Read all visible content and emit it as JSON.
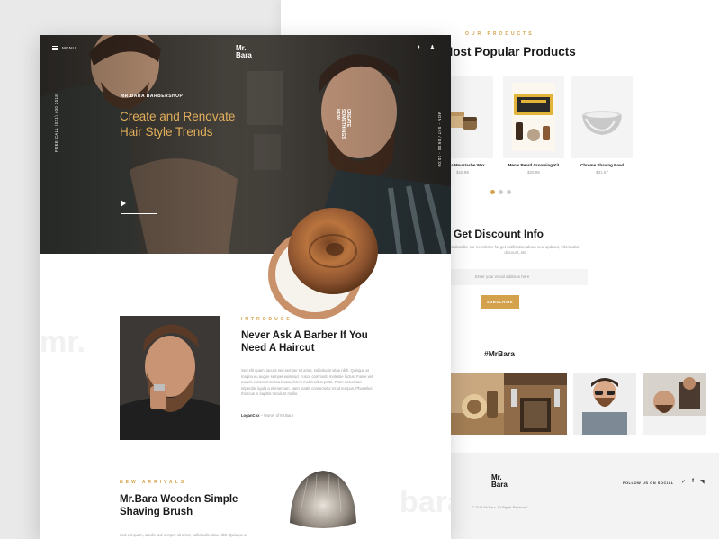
{
  "products": {
    "eyebrow": "OUR PRODUCTS",
    "title": "Most Popular Products",
    "items": [
      {
        "name": "Vanilla Moustache Wax",
        "price": "$18.99"
      },
      {
        "name": "Men's Beard Grooming Kit",
        "price": "$25.95"
      },
      {
        "name": "Chrome Shaving Bowl",
        "price": "$31.57"
      }
    ]
  },
  "discount": {
    "title": "Get Discount Info",
    "subtitle": "Subscribe our newsletter for get notification about new updates, information discount, etc.",
    "placeholder": "Enter your email address here",
    "button": "SUBSCRIBE"
  },
  "gallery": {
    "hashtag": "#MrBara"
  },
  "footer": {
    "logo_line1": "Mr.",
    "logo_line2": "Bara",
    "copyright": "© 2018 Mr.Bara. All Rights Reserved",
    "follow": "FOLLOW US ON SOCIAL"
  },
  "header": {
    "menu": "MENU",
    "logo_line1": "Mr.",
    "logo_line2": "Bara"
  },
  "hero": {
    "eyebrow": "MR.BARA BARBERSHOP",
    "title": "Create and Renovate Hair Style Trends",
    "side_left": "FREE CALL (021) 400 2018",
    "side_right": "MON - SAT / 09:00 - 20:00",
    "new_line1": "CREATE",
    "new_line2": "SOMETHINGS",
    "new_line3": "NEW"
  },
  "intro": {
    "eyebrow": "INTRODUCE",
    "title": "Never Ask A Barber If You Need  A Haircut",
    "body": "Sed elit quam, iaculis sed semper sit amet, sollicitudin vitae nibh. Quisque at magna eu augue semper euismod. Fusce commodo molestie luctus. Fusce vel mauris euismod massa luctus, lorem mollis tellus porta. Proin accumsan imperdiet ligula a elementum. Nam mattis consectetur mi ut tempus. Phasellus rhoncus in sagittis tincidunt mollis.",
    "sig_name": "LoganCox",
    "sig_role": " – Owner of Mr.Bara"
  },
  "arrivals": {
    "eyebrow": "NEW ARRIVALS",
    "title": "Mr.Bara Wooden Simple Shaving Brush",
    "body": "Sed elit quam, iaculis sed semper sit amet, sollicitudin vitae nibh. Quisque at"
  },
  "watermarks": {
    "mr": "mr.",
    "bara": "bara"
  },
  "colors": {
    "accent": "#d4a24c",
    "dark": "#1a1a1a",
    "muted": "#999999"
  }
}
